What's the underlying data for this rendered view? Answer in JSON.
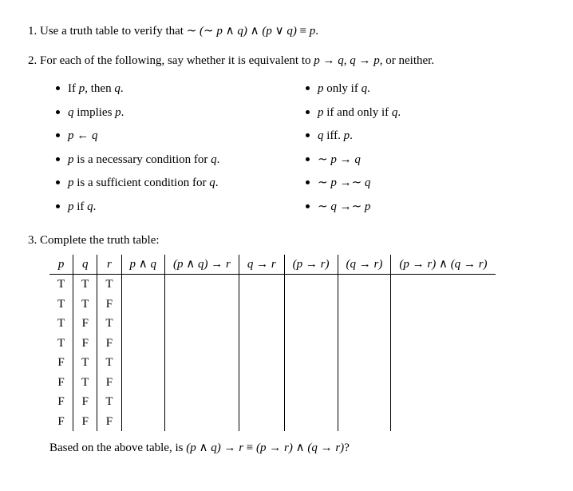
{
  "q1_prefix": "Use a truth table to verify that ",
  "q1_expr": "∼ (∼ p ∧ q) ∧ (p ∨ q) ≡ p",
  "q1_suffix": ".",
  "q2_prefix": "For each of the following, say whether it is equivalent to ",
  "q2_mid1": "p → q",
  "q2_sep": ", ",
  "q2_mid2": "q → p",
  "q2_suffix": ", or neither.",
  "left": [
    "If p, then q.",
    "q implies p.",
    "p ← q",
    "p is a necessary condition for q.",
    "p is a sufficient condition for q.",
    "p if q."
  ],
  "right": [
    "p only if q.",
    "p if and only if q.",
    "q iff. p.",
    "∼ p → q",
    "∼ p → ∼ q",
    "∼ q → ∼ p"
  ],
  "q3_text": "Complete the truth table:",
  "headers": [
    "p",
    "q",
    "r",
    "p ∧ q",
    "(p ∧ q) → r",
    "q → r",
    "(p → r)",
    "(q → r)",
    "(p → r) ∧ (q → r)"
  ],
  "rows": [
    [
      "T",
      "T",
      "T",
      "",
      "",
      "",
      "",
      "",
      ""
    ],
    [
      "T",
      "T",
      "F",
      "",
      "",
      "",
      "",
      "",
      ""
    ],
    [
      "T",
      "F",
      "T",
      "",
      "",
      "",
      "",
      "",
      ""
    ],
    [
      "T",
      "F",
      "F",
      "",
      "",
      "",
      "",
      "",
      ""
    ],
    [
      "F",
      "T",
      "T",
      "",
      "",
      "",
      "",
      "",
      ""
    ],
    [
      "F",
      "T",
      "F",
      "",
      "",
      "",
      "",
      "",
      ""
    ],
    [
      "F",
      "F",
      "T",
      "",
      "",
      "",
      "",
      "",
      ""
    ],
    [
      "F",
      "F",
      "F",
      "",
      "",
      "",
      "",
      "",
      ""
    ]
  ],
  "q3b_prefix": "Based on the above table, is ",
  "q3b_expr": "(p ∧ q) → r ≡ (p → r) ∧ (q → r)",
  "q3b_suffix": "?",
  "chart_data": {
    "type": "table",
    "title": "Truth table scaffold for (p∧q)→r vs (p→r)∧(q→r)",
    "columns": [
      "p",
      "q",
      "r",
      "p ∧ q",
      "(p ∧ q) → r",
      "q → r",
      "(p → r)",
      "(q → r)",
      "(p → r) ∧ (q → r)"
    ],
    "rows": [
      [
        "T",
        "T",
        "T",
        null,
        null,
        null,
        null,
        null,
        null
      ],
      [
        "T",
        "T",
        "F",
        null,
        null,
        null,
        null,
        null,
        null
      ],
      [
        "T",
        "F",
        "T",
        null,
        null,
        null,
        null,
        null,
        null
      ],
      [
        "T",
        "F",
        "F",
        null,
        null,
        null,
        null,
        null,
        null
      ],
      [
        "F",
        "T",
        "T",
        null,
        null,
        null,
        null,
        null,
        null
      ],
      [
        "F",
        "T",
        "F",
        null,
        null,
        null,
        null,
        null,
        null
      ],
      [
        "F",
        "F",
        "T",
        null,
        null,
        null,
        null,
        null,
        null
      ],
      [
        "F",
        "F",
        "F",
        null,
        null,
        null,
        null,
        null,
        null
      ]
    ]
  }
}
